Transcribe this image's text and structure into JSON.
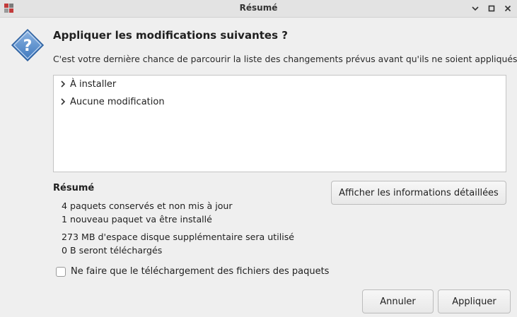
{
  "window": {
    "title": "Résumé",
    "controls": [
      "minimize",
      "maximize",
      "close"
    ]
  },
  "dialog": {
    "icon": "question-icon",
    "heading": "Appliquer les modifications suivantes ?",
    "subtitle": "C'est votre dernière chance de parcourir la liste des changements prévus avant qu'ils ne soient appliqués."
  },
  "tree": {
    "items": [
      {
        "label": "À installer",
        "expanded": false
      },
      {
        "label": "Aucune modification",
        "expanded": false
      }
    ]
  },
  "summary": {
    "title": "Résumé",
    "lines": [
      "4 paquets conservés et non mis à jour",
      "1 nouveau paquet va être installé",
      "273 MB d'espace disque supplémentaire sera utilisé",
      "0  B seront téléchargés"
    ],
    "details_button": "Afficher les informations détaillées"
  },
  "download_only": {
    "label": "Ne faire que le téléchargement des fichiers des paquets",
    "checked": false
  },
  "buttons": {
    "cancel": "Annuler",
    "apply": "Appliquer"
  }
}
